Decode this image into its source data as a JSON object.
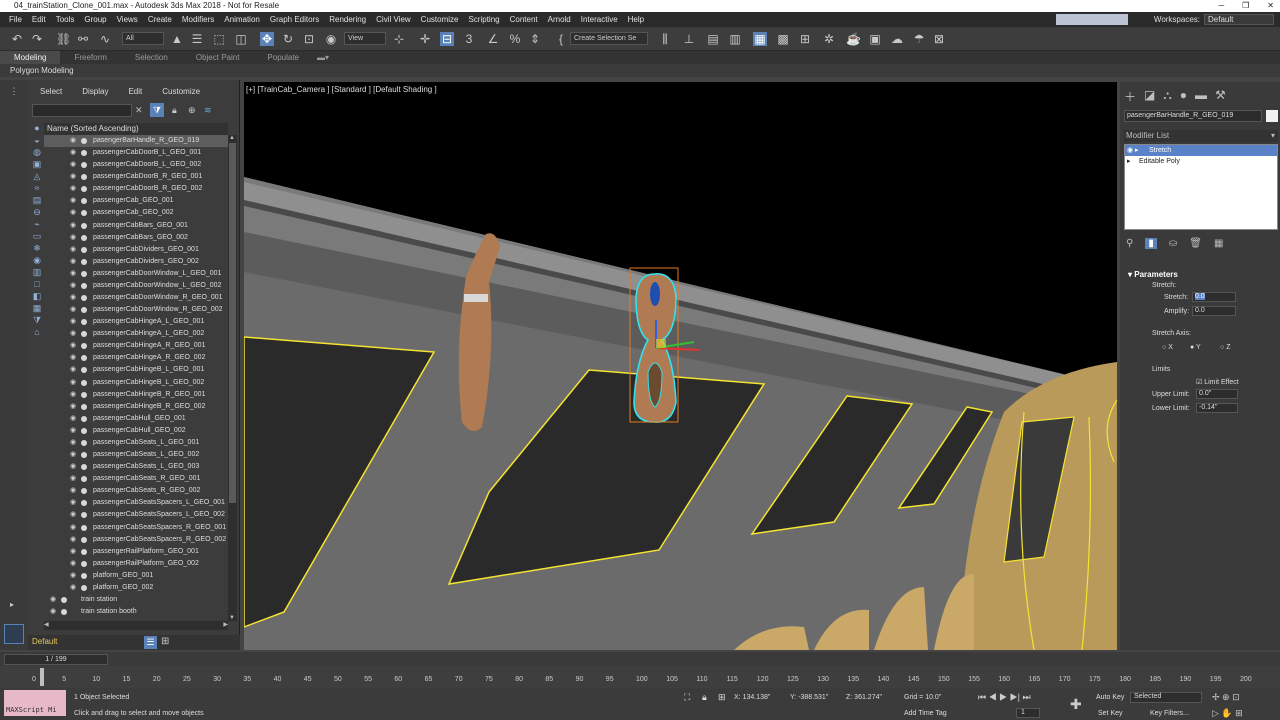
{
  "window": {
    "title": "04_trainStation_Clone_001.max - Autodesk 3ds Max 2018 - Not for Resale",
    "controls": [
      "─",
      "❐",
      "✕"
    ]
  },
  "menu": [
    "File",
    "Edit",
    "Tools",
    "Group",
    "Views",
    "Create",
    "Modifiers",
    "Animation",
    "Graph Editors",
    "Rendering",
    "Civil View",
    "Customize",
    "Scripting",
    "Content",
    "Arnold",
    "Interactive",
    "Help"
  ],
  "workspace": {
    "label": "Workspaces:",
    "value": "Default"
  },
  "toolbar": {
    "filter": "All",
    "ref_coord": "View",
    "selection_set": "Create Selection Se"
  },
  "ribbon": {
    "tabs": [
      "Modeling",
      "Freeform",
      "Selection",
      "Object Paint",
      "Populate"
    ],
    "active": "Modeling",
    "sub": "Polygon Modeling"
  },
  "explorer": {
    "menu": [
      "Select",
      "Display",
      "Edit",
      "Customize"
    ],
    "header": "Name (Sorted Ascending)",
    "selected": "pasengerBarHandle_R_GEO_019",
    "items": [
      "pasengerBarHandle_R_GEO_019",
      "passengerCabDoorB_L_GEO_001",
      "passengerCabDoorB_L_GEO_002",
      "passengerCabDoorB_R_GEO_001",
      "passengerCabDoorB_R_GEO_002",
      "passengerCab_GEO_001",
      "passengerCab_GEO_002",
      "passengerCabBars_GEO_001",
      "passengerCabBars_GEO_002",
      "passengerCabDividers_GEO_001",
      "passengerCabDividers_GEO_002",
      "passengerCabDoorWindow_L_GEO_001",
      "passengerCabDoorWindow_L_GEO_002",
      "passengerCabDoorWindow_R_GEO_001",
      "passengerCabDoorWindow_R_GEO_002",
      "passengerCabHingeA_L_GEO_001",
      "passengerCabHingeA_L_GEO_002",
      "passengerCabHingeA_R_GEO_001",
      "passengerCabHingeA_R_GEO_002",
      "passengerCabHingeB_L_GEO_001",
      "passengerCabHingeB_L_GEO_002",
      "passengerCabHingeB_R_GEO_001",
      "passengerCabHingeB_R_GEO_002",
      "passengerCabHull_GEO_001",
      "passengerCabHull_GEO_002",
      "passengerCabSeats_L_GEO_001",
      "passengerCabSeats_L_GEO_002",
      "passengerCabSeats_L_GEO_003",
      "passengerCabSeats_R_GEO_001",
      "passengerCabSeats_R_GEO_002",
      "passengerCabSeatsSpacers_L_GEO_001",
      "passengerCabSeatsSpacers_L_GEO_002",
      "passengerCabSeatsSpacers_R_GEO_001",
      "passengerCabSeatsSpacers_R_GEO_002",
      "passengerRailPlatform_GEO_001",
      "passengerRailPlatform_GEO_002",
      "platform_GEO_001",
      "platform_GEO_002"
    ],
    "groups": [
      "train station",
      "train station booth"
    ],
    "layer": "Default"
  },
  "viewport": {
    "label": "[+] [TrainCab_Camera ] [Standard ] [Default Shading ]"
  },
  "command_panel": {
    "object_name": "pasengerBarHandle_R_GEO_019",
    "modifier_list": "Modifier List",
    "stack": [
      "Stretch",
      "Editable Poly"
    ],
    "rollout": "Parameters",
    "stretch_group": "Stretch:",
    "stretch_label": "Stretch:",
    "stretch_value": "0.0",
    "amplify_label": "Amplify:",
    "amplify_value": "0.0",
    "axis_label": "Stretch Axis:",
    "axes": [
      "X",
      "Y",
      "Z"
    ],
    "limits_label": "Limits",
    "limit_effect": "Limit Effect",
    "upper_label": "Upper Limit:",
    "upper_value": "0.0\"",
    "lower_label": "Lower Limit:",
    "lower_value": "-0.14\""
  },
  "timeline": {
    "frame": "1 / 199",
    "ticks": [
      "0",
      "5",
      "10",
      "15",
      "20",
      "25",
      "30",
      "35",
      "40",
      "45",
      "50",
      "55",
      "60",
      "65",
      "70",
      "75",
      "80",
      "85",
      "90",
      "95",
      "100",
      "105",
      "110",
      "115",
      "120",
      "125",
      "130",
      "135",
      "140",
      "145",
      "150",
      "155",
      "160",
      "165",
      "170",
      "175",
      "180",
      "185",
      "190",
      "195",
      "200"
    ]
  },
  "status": {
    "maxscript": "MAXScript Mi",
    "selected": "1 Object Selected",
    "prompt": "Click and drag to select and move objects",
    "x": "134.138\"",
    "y": "-388.531\"",
    "z": "361.274\"",
    "grid": "Grid = 10.0\"",
    "add_time_tag": "Add Time Tag",
    "frame": "1",
    "auto_key": "Auto Key",
    "set_key": "Set Key",
    "key_sel": "Selected",
    "key_filters": "Key Filters..."
  }
}
